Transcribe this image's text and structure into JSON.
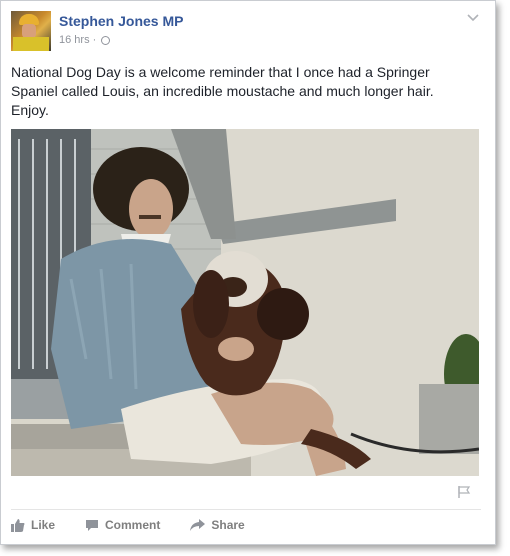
{
  "post": {
    "author": "Stephen Jones MP",
    "time": "16 hrs",
    "separator": "·",
    "text": "National Dog Day is a welcome reminder that I once had a Springer\nSpaniel called Louis, an incredible moustache and much longer hair.\nEnjoy."
  },
  "actions": {
    "like": "Like",
    "comment": "Comment",
    "share": "Share"
  },
  "icons": {
    "avatar": "profile-photo",
    "audience": "globe-icon",
    "menu": "chevron-down-icon",
    "report": "flag-icon",
    "like": "thumbs-up-icon",
    "comment": "speech-bubble-icon",
    "share": "share-arrow-icon"
  },
  "colors": {
    "author": "#365899",
    "meta": "#90949c",
    "text": "#1d2129",
    "action": "#7f7f7f"
  }
}
